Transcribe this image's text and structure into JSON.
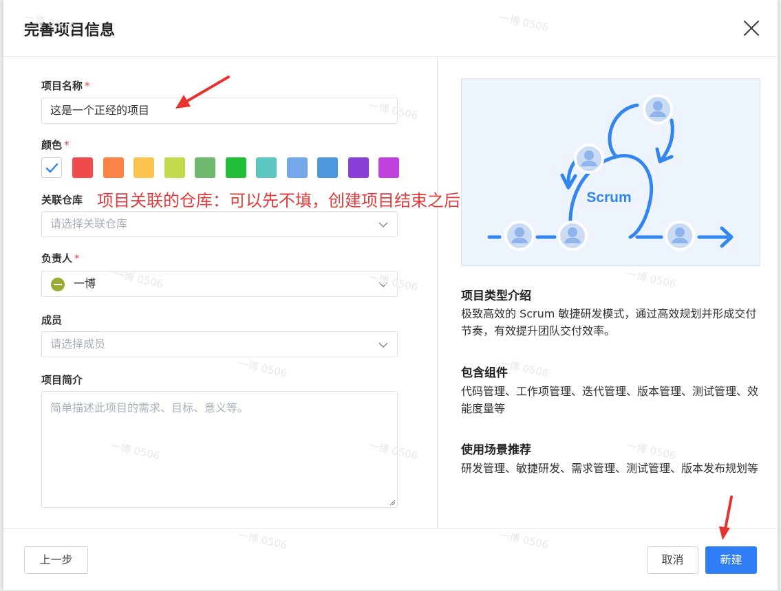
{
  "dialog": {
    "title": "完善项目信息",
    "close_icon": "close-icon"
  },
  "form": {
    "name_label": "项目名称",
    "name_value": "这是一个正经的项目",
    "color_label": "颜色",
    "colors": [
      "#ef4b4b",
      "#fb8346",
      "#fcc44f",
      "#c2da4c",
      "#71b96f",
      "#23be38",
      "#5cc6c0",
      "#74a8ea",
      "#4d98dd",
      "#8a3fd6",
      "#c242dd"
    ],
    "selected_color": "none",
    "repo_label": "关联仓库",
    "repo_placeholder": "请选择关联仓库",
    "owner_label": "负责人",
    "owner_value": "一博",
    "owner_avatar_color": "#9aac32",
    "members_label": "成员",
    "members_placeholder": "请选择成员",
    "intro_label": "项目简介",
    "intro_placeholder": "简单描述此项目的需求、目标、意义等。",
    "required_mark": "*"
  },
  "annotation": {
    "text": "项目关联的仓库：可以先不填，创建项目结束之后修改即可",
    "color": "#e23b3b"
  },
  "info": {
    "illustration_label": "Scrum",
    "type_title": "项目类型介绍",
    "type_text": "极致高效的 Scrum 敏捷研发模式，通过高效规划并形成交付节奏，有效提升团队交付效率。",
    "components_title": "包含组件",
    "components_text": "代码管理、工作项管理、迭代管理、版本管理、测试管理、效能度量等",
    "scenes_title": "使用场景推荐",
    "scenes_text": "研发管理、敏捷研发、需求管理、测试管理、版本发布规划等"
  },
  "footer": {
    "prev_label": "上一步",
    "cancel_label": "取消",
    "create_label": "新建"
  },
  "watermark": "一博 0506",
  "theme": {
    "primary": "#2f7ef5",
    "scrum_blue": "#3385f0"
  }
}
